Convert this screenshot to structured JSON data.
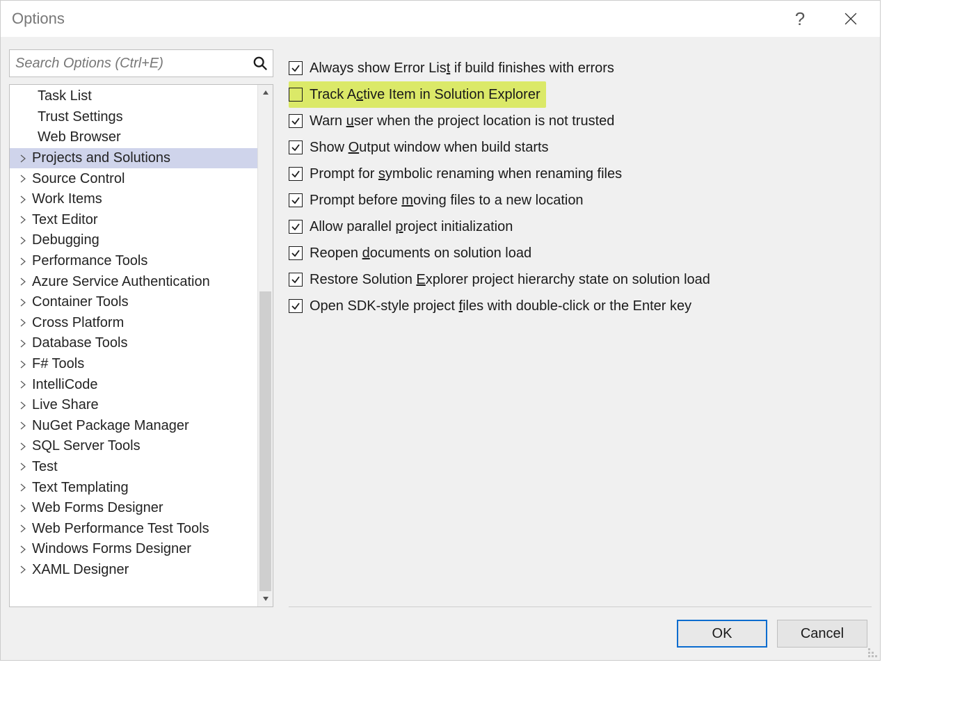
{
  "dialog": {
    "title": "Options"
  },
  "search": {
    "placeholder": "Search Options (Ctrl+E)"
  },
  "tree": {
    "items": [
      {
        "label": "Task List",
        "type": "leaf",
        "selected": false
      },
      {
        "label": "Trust Settings",
        "type": "leaf",
        "selected": false
      },
      {
        "label": "Web Browser",
        "type": "leaf",
        "selected": false
      },
      {
        "label": "Projects and Solutions",
        "type": "branch",
        "selected": true
      },
      {
        "label": "Source Control",
        "type": "branch",
        "selected": false
      },
      {
        "label": "Work Items",
        "type": "branch",
        "selected": false
      },
      {
        "label": "Text Editor",
        "type": "branch",
        "selected": false
      },
      {
        "label": "Debugging",
        "type": "branch",
        "selected": false
      },
      {
        "label": "Performance Tools",
        "type": "branch",
        "selected": false
      },
      {
        "label": "Azure Service Authentication",
        "type": "branch",
        "selected": false
      },
      {
        "label": "Container Tools",
        "type": "branch",
        "selected": false
      },
      {
        "label": "Cross Platform",
        "type": "branch",
        "selected": false
      },
      {
        "label": "Database Tools",
        "type": "branch",
        "selected": false
      },
      {
        "label": "F# Tools",
        "type": "branch",
        "selected": false
      },
      {
        "label": "IntelliCode",
        "type": "branch",
        "selected": false
      },
      {
        "label": "Live Share",
        "type": "branch",
        "selected": false
      },
      {
        "label": "NuGet Package Manager",
        "type": "branch",
        "selected": false
      },
      {
        "label": "SQL Server Tools",
        "type": "branch",
        "selected": false
      },
      {
        "label": "Test",
        "type": "branch",
        "selected": false
      },
      {
        "label": "Text Templating",
        "type": "branch",
        "selected": false
      },
      {
        "label": "Web Forms Designer",
        "type": "branch",
        "selected": false
      },
      {
        "label": "Web Performance Test Tools",
        "type": "branch",
        "selected": false
      },
      {
        "label": "Windows Forms Designer",
        "type": "branch",
        "selected": false
      },
      {
        "label": "XAML Designer",
        "type": "branch",
        "selected": false
      }
    ]
  },
  "checks": [
    {
      "checked": true,
      "highlighted": false,
      "pre": "Always show Error Lis",
      "u": "t",
      "post": " if build finishes with errors"
    },
    {
      "checked": false,
      "highlighted": true,
      "pre": "Track A",
      "u": "c",
      "post": "tive Item in Solution Explorer"
    },
    {
      "checked": true,
      "highlighted": false,
      "pre": "Warn ",
      "u": "u",
      "post": "ser when the project location is not trusted"
    },
    {
      "checked": true,
      "highlighted": false,
      "pre": "Show ",
      "u": "O",
      "post": "utput window when build starts"
    },
    {
      "checked": true,
      "highlighted": false,
      "pre": "Prompt for ",
      "u": "s",
      "post": "ymbolic renaming when renaming files"
    },
    {
      "checked": true,
      "highlighted": false,
      "pre": "Prompt before ",
      "u": "m",
      "post": "oving files to a new location"
    },
    {
      "checked": true,
      "highlighted": false,
      "pre": "Allow parallel ",
      "u": "p",
      "post": "roject initialization"
    },
    {
      "checked": true,
      "highlighted": false,
      "pre": "Reopen ",
      "u": "d",
      "post": "ocuments on solution load"
    },
    {
      "checked": true,
      "highlighted": false,
      "pre": "Restore Solution ",
      "u": "E",
      "post": "xplorer project hierarchy state on solution load"
    },
    {
      "checked": true,
      "highlighted": false,
      "pre": "Open SDK-style project ",
      "u": "f",
      "post": "iles with double-click or the Enter key"
    }
  ],
  "buttons": {
    "ok": "OK",
    "cancel": "Cancel"
  }
}
